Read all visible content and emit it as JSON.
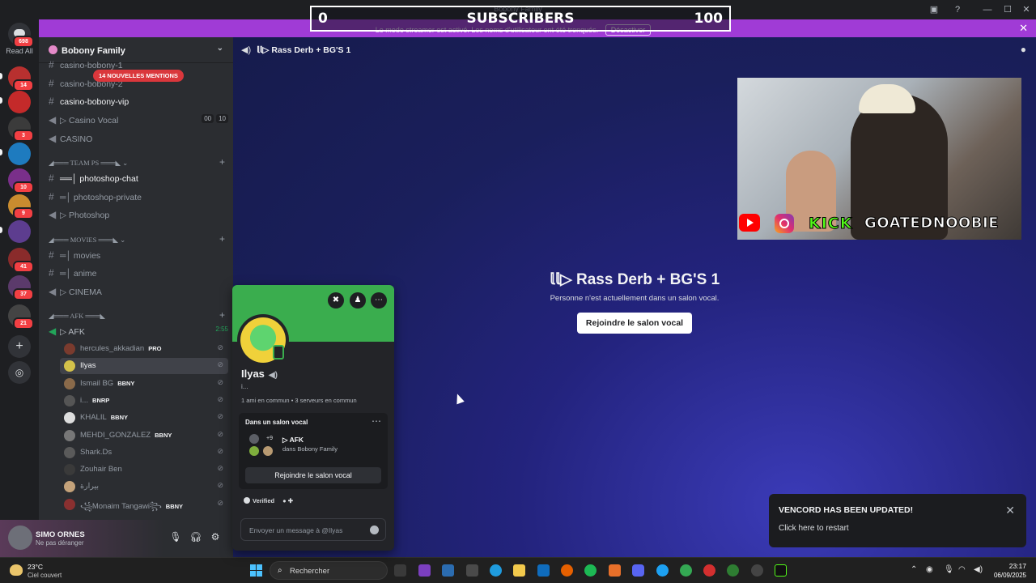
{
  "window": {
    "title": "Bobony Family"
  },
  "overlay": {
    "subs_left": "0",
    "subs_label": "SUBSCRIBERS",
    "subs_right": "100"
  },
  "streamer_bar": {
    "message": "Le mode streamer est activé. Les noms d'utilisateur ont été tronqués.",
    "deactivate_label": "Désactiver"
  },
  "rail": {
    "read_all_label": "Read All",
    "home_badge": "698",
    "servers": [
      {
        "badge": "14",
        "color": "#b8302f"
      },
      {
        "badge": "",
        "color": "#c42a2a"
      },
      {
        "badge": "3",
        "color": "#3b3b3b"
      },
      {
        "badge": "",
        "color": "#1e7bbf"
      },
      {
        "badge": "10",
        "color": "#7a2f8a"
      },
      {
        "badge": "9",
        "color": "#c98c2f"
      },
      {
        "badge": "",
        "color": "#5d3d8f"
      },
      {
        "badge": "41",
        "color": "#8a2b2b"
      },
      {
        "badge": "37",
        "color": "#5b3a6b"
      },
      {
        "badge": "21",
        "color": "#444444"
      }
    ]
  },
  "server": {
    "name": "Bobony Family"
  },
  "mentions_pill": "14 NOUVELLES MENTIONS",
  "channels": [
    {
      "label": "casino-bobony-1",
      "type": "text"
    },
    {
      "label": "casino-bobony-2",
      "type": "text"
    },
    {
      "label": "casino-bobony-vip",
      "type": "text",
      "active": true
    },
    {
      "label": "▷ Casino Vocal",
      "type": "voice",
      "count_a": "00",
      "count_b": "10"
    },
    {
      "label": "CASINO",
      "type": "voice"
    },
    {
      "label": "══│ photoshop-chat",
      "type": "text",
      "active": true
    },
    {
      "label": "═│ photoshop-private",
      "type": "text"
    },
    {
      "label": "▷ Photoshop",
      "type": "voice"
    },
    {
      "label": "═│ movies",
      "type": "text"
    },
    {
      "label": "═│ anime",
      "type": "text"
    },
    {
      "label": "▷ CINEMA",
      "type": "voice"
    },
    {
      "label": "▷ AFK",
      "type": "voice",
      "timer": "2:55"
    }
  ],
  "categories": [
    "TEAM PS",
    "MOVIES",
    "AFK"
  ],
  "voice_users": [
    {
      "name": "hercules_akkadian",
      "tag": "PRO",
      "color": "#7a3b2e"
    },
    {
      "name": "Ilyas",
      "tag": "",
      "color": "#d4c24a",
      "selected": true
    },
    {
      "name": "Ismail BG",
      "tag": "BBNY",
      "color": "#8a6a4a"
    },
    {
      "name": "i...",
      "tag": "BNRP",
      "color": "#555555"
    },
    {
      "name": "KHALIL",
      "tag": "BBNY",
      "color": "#dddddd"
    },
    {
      "name": "MEHDI_GONZALEZ",
      "tag": "BBNY",
      "color": "#777777"
    },
    {
      "name": "Shark.Ds",
      "tag": "",
      "color": "#5a5a5a"
    },
    {
      "name": "Zouhair Ben",
      "tag": "",
      "color": "#3a3a3a"
    },
    {
      "name": "بيرارة",
      "tag": "",
      "color": "#c4a27a"
    },
    {
      "name": "꧁Monaim Tangawi꧂",
      "tag": "BBNY",
      "color": "#8a3030"
    }
  ],
  "user_panel": {
    "name": "SIMO ORNES",
    "status": "Ne pas déranger"
  },
  "main": {
    "channel_title": "𝕝𝕝▷ Rass Derb + BG'S 1",
    "center_title": "𝕝𝕝▷ Rass Derb + BG'S 1",
    "center_sub": "Personne n'est actuellement dans un salon vocal.",
    "join_label": "Rejoindre le salon vocal",
    "webcam_kick": "KICK",
    "webcam_handle": "GOATEDNOOBIE"
  },
  "profile": {
    "name": "Ilyas",
    "status": "i...",
    "mutual": "1 ami en commun • 3 serveurs en commun",
    "in_voice_label": "Dans un salon vocal",
    "vc_plus": "+9",
    "vc_name": "▷ AFK",
    "vc_server": "dans Bobony Family",
    "join_label": "Rejoindre le salon vocal",
    "verified": "Verified",
    "message_placeholder": "Envoyer un message à @Ilyas"
  },
  "toast": {
    "title": "VENCORD HAS BEEN UPDATED!",
    "body": "Click here to restart"
  },
  "taskbar": {
    "temp": "23°C",
    "condition": "Ciel couvert",
    "search_placeholder": "Rechercher",
    "time": "23:17",
    "date": "06/09/2025"
  }
}
